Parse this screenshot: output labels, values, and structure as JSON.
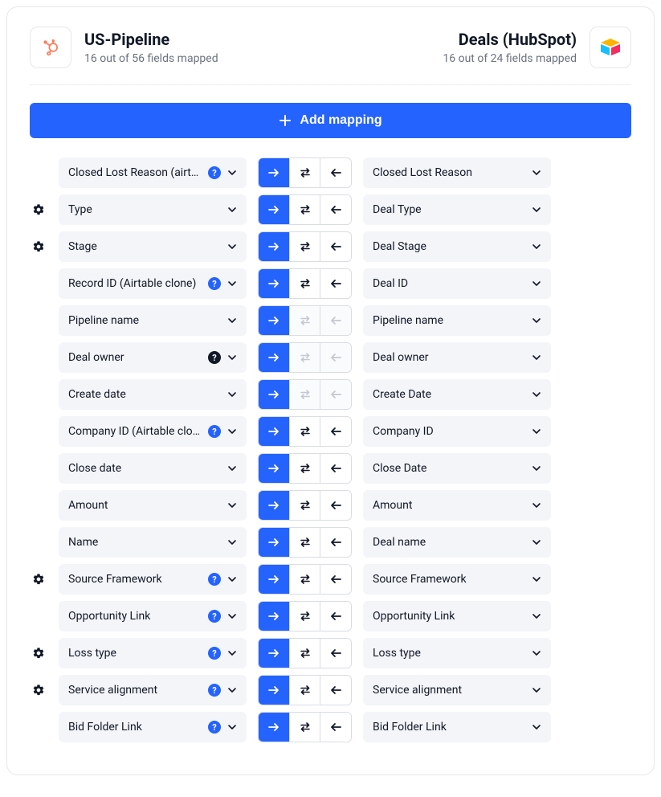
{
  "header": {
    "left": {
      "title": "US-Pipeline",
      "subtitle": "16 out of 56 fields mapped"
    },
    "right": {
      "title": "Deals (HubSpot)",
      "subtitle": "16 out of 24 fields mapped"
    }
  },
  "add_button_label": "Add mapping",
  "rows": [
    {
      "gear": false,
      "left": "Closed Lost Reason (airtable …",
      "left_badge": "blue",
      "right": "Closed Lost Reason",
      "dir_disabled": false
    },
    {
      "gear": true,
      "left": "Type",
      "left_badge": null,
      "right": "Deal Type",
      "dir_disabled": false
    },
    {
      "gear": true,
      "left": "Stage",
      "left_badge": null,
      "right": "Deal Stage",
      "dir_disabled": false
    },
    {
      "gear": false,
      "left": "Record ID (Airtable clone)",
      "left_badge": "blue",
      "right": "Deal ID",
      "dir_disabled": false
    },
    {
      "gear": false,
      "left": "Pipeline name",
      "left_badge": null,
      "right": "Pipeline name",
      "dir_disabled": true
    },
    {
      "gear": false,
      "left": "Deal owner",
      "left_badge": "black",
      "right": "Deal owner",
      "dir_disabled": true
    },
    {
      "gear": false,
      "left": "Create date",
      "left_badge": null,
      "right": "Create Date",
      "dir_disabled": true
    },
    {
      "gear": false,
      "left": "Company ID (Airtable clone)",
      "left_badge": "blue",
      "right": "Company ID",
      "dir_disabled": false
    },
    {
      "gear": false,
      "left": "Close date",
      "left_badge": null,
      "right": "Close Date",
      "dir_disabled": false
    },
    {
      "gear": false,
      "left": "Amount",
      "left_badge": null,
      "right": "Amount",
      "dir_disabled": false
    },
    {
      "gear": false,
      "left": "Name",
      "left_badge": null,
      "right": "Deal name",
      "dir_disabled": false
    },
    {
      "gear": true,
      "left": "Source Framework",
      "left_badge": "blue",
      "right": "Source Framework",
      "dir_disabled": false
    },
    {
      "gear": false,
      "left": "Opportunity Link",
      "left_badge": "blue",
      "right": "Opportunity Link",
      "dir_disabled": false
    },
    {
      "gear": true,
      "left": "Loss type",
      "left_badge": "blue",
      "right": "Loss type",
      "dir_disabled": false
    },
    {
      "gear": true,
      "left": "Service alignment",
      "left_badge": "blue",
      "right": "Service alignment",
      "dir_disabled": false
    },
    {
      "gear": false,
      "left": "Bid Folder Link",
      "left_badge": "blue",
      "right": "Bid Folder Link",
      "dir_disabled": false
    }
  ]
}
